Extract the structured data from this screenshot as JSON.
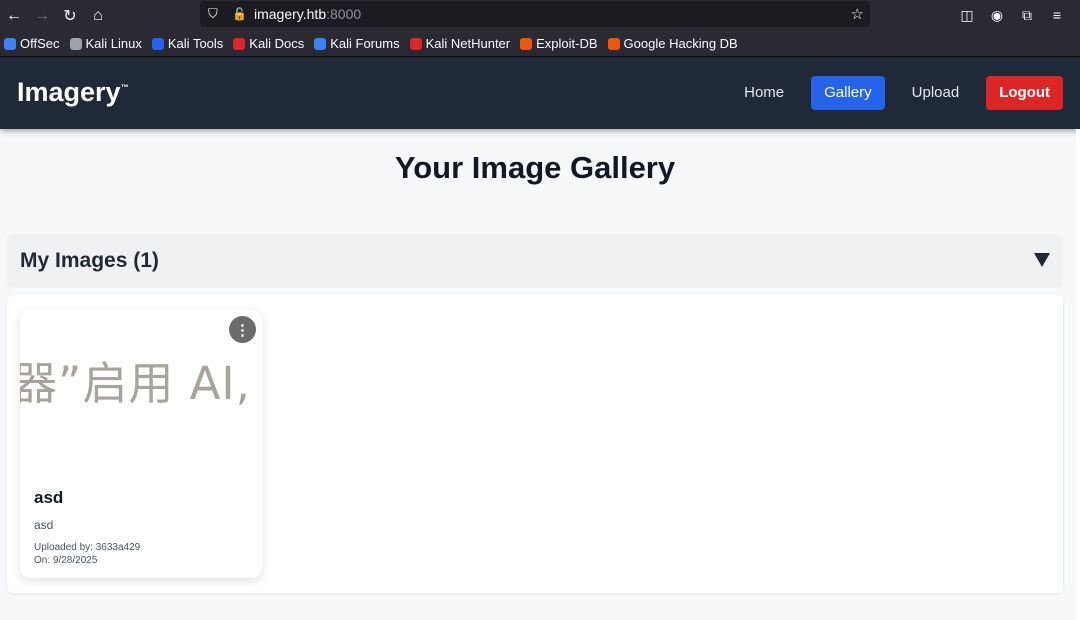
{
  "browser": {
    "url_host": "imagery.htb",
    "url_port": ":8000",
    "bookmarks": [
      {
        "label": "OffSec",
        "color": "#3b82f6"
      },
      {
        "label": "Kali Linux",
        "color": "#9ca3af"
      },
      {
        "label": "Kali Tools",
        "color": "#2563eb"
      },
      {
        "label": "Kali Docs",
        "color": "#dc2626"
      },
      {
        "label": "Kali Forums",
        "color": "#3b82f6"
      },
      {
        "label": "Kali NetHunter",
        "color": "#dc2626"
      },
      {
        "label": "Exploit-DB",
        "color": "#ea580c"
      },
      {
        "label": "Google Hacking DB",
        "color": "#ea580c"
      }
    ]
  },
  "site": {
    "logo": "Imagery",
    "logo_mark": "™",
    "nav": {
      "home": "Home",
      "gallery": "Gallery",
      "upload": "Upload",
      "logout": "Logout"
    },
    "accent_color": "#2563eb",
    "danger_color": "#dc2626"
  },
  "page": {
    "title": "Your Image Gallery",
    "section_title": "My Images (1)"
  },
  "images": [
    {
      "thumb_text": "器”启用 AI,",
      "title": "asd",
      "description": "asd",
      "uploaded_by": "Uploaded by: 3633a429",
      "date": "On: 9/28/2025",
      "menu_icon": "⋮"
    }
  ]
}
